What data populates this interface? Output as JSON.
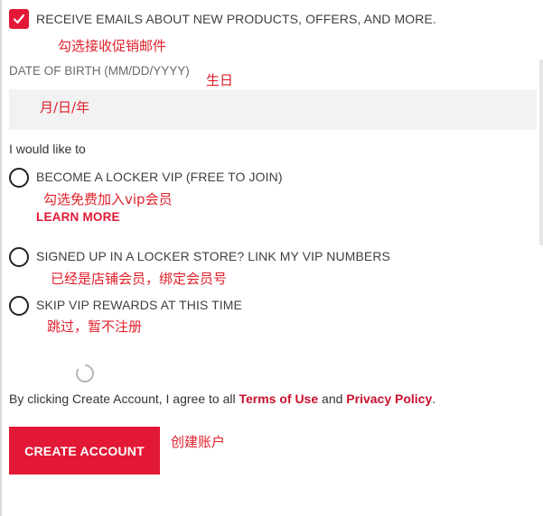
{
  "email_opt_in": {
    "checked": true,
    "label": "RECEIVE EMAILS ABOUT NEW PRODUCTS, OFFERS, AND MORE.",
    "annotation": "勾选接收促销邮件"
  },
  "dob": {
    "label": "DATE OF BIRTH (MM/DD/YYYY)",
    "annotation": "生日",
    "placeholder": "月/日/年"
  },
  "vip_section": {
    "label": "I would like to",
    "options": [
      {
        "label": "BECOME A LOCKER VIP (FREE TO JOIN)",
        "annotation": "勾选免费加入vip会员",
        "link": "LEARN MORE",
        "selected": false
      },
      {
        "label": "SIGNED UP IN A LOCKER STORE? LINK MY VIP NUMBERS",
        "annotation": "已经是店铺会员，绑定会员号",
        "selected": false
      },
      {
        "label": "SKIP VIP REWARDS AT THIS TIME",
        "annotation": "跳过，暂不注册",
        "selected": false
      }
    ]
  },
  "terms": {
    "prefix": "By clicking Create Account, I agree to all ",
    "terms_link": "Terms of Use",
    "middle": " and ",
    "privacy_link": "Privacy Policy",
    "suffix": "."
  },
  "create_account": {
    "label": "CREATE ACCOUNT",
    "annotation": "创建账户"
  },
  "colors": {
    "accent": "#e21836",
    "annotation": "#e0202a",
    "input_bg": "#f2f2f2"
  }
}
